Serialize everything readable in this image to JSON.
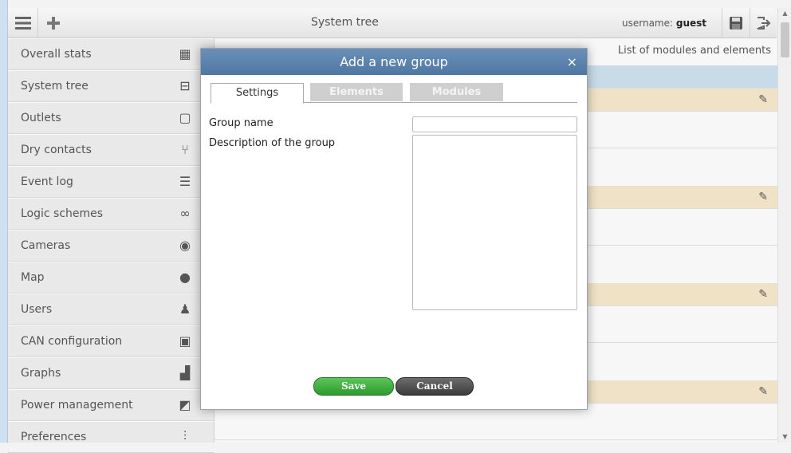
{
  "topbar": {
    "title": "System tree",
    "user_prefix": "username: ",
    "user_name": "guest",
    "menu_icon": "hamburger-icon",
    "add_icon": "plus-icon",
    "save_icon": "floppy-disk-icon",
    "logout_icon": "logout-icon"
  },
  "sidebar": {
    "items": [
      {
        "label": "Overall stats",
        "icon": "grid-icon"
      },
      {
        "label": "System tree",
        "icon": "tree-icon"
      },
      {
        "label": "Outlets",
        "icon": "outlet-icon"
      },
      {
        "label": "Dry contacts",
        "icon": "switch-icon"
      },
      {
        "label": "Event log",
        "icon": "list-icon"
      },
      {
        "label": "Logic schemes",
        "icon": "link-icon"
      },
      {
        "label": "Cameras",
        "icon": "eye-icon"
      },
      {
        "label": "Map",
        "icon": "map-pin-icon"
      },
      {
        "label": "Users",
        "icon": "users-icon"
      },
      {
        "label": "CAN configuration",
        "icon": "can-icon"
      },
      {
        "label": "Graphs",
        "icon": "bar-chart-icon"
      },
      {
        "label": "Power management",
        "icon": "power-icon"
      },
      {
        "label": "Preferences",
        "icon": "sliders-icon"
      }
    ]
  },
  "main": {
    "list_title": "List of modules and elements"
  },
  "dialog": {
    "title": "Add a new group",
    "close": "×",
    "tabs": [
      "Settings",
      "Elements",
      "Modules"
    ],
    "group_name_label": "Group name",
    "group_name_value": "",
    "description_label": "Description of the group",
    "description_value": "",
    "save_label": "Save",
    "cancel_label": "Cancel"
  },
  "colors": {
    "dialog_header": "#5a83ae",
    "save_button": "#3aaa3a",
    "cancel_button": "#505050",
    "row_tan": "#efe2c6",
    "row_blue": "#c7dbe8"
  }
}
